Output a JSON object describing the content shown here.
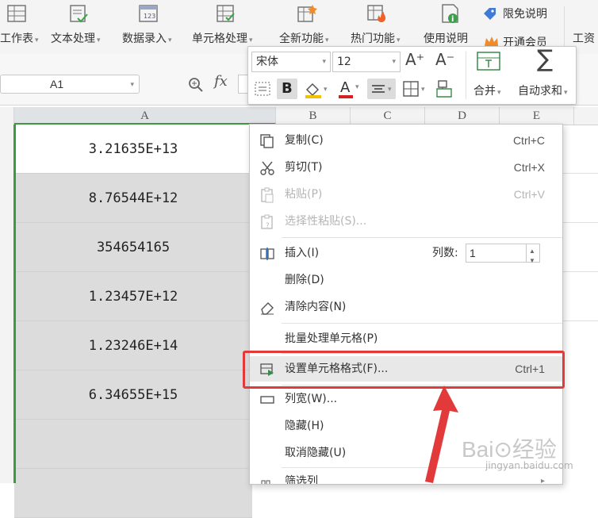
{
  "ribbon": {
    "items": [
      {
        "label": "工作表"
      },
      {
        "label": "文本处理"
      },
      {
        "label": "数据录入"
      },
      {
        "label": "单元格处理"
      },
      {
        "label": "全新功能"
      },
      {
        "label": "热门功能"
      },
      {
        "label": "使用说明"
      }
    ],
    "free_link": "限免说明",
    "vip_link": "开通会员",
    "tools_label": "工资"
  },
  "formula_bar": {
    "name_box": "A1",
    "fx_label": "fx"
  },
  "columns": [
    "A",
    "B",
    "C",
    "D",
    "E"
  ],
  "cells": [
    "3.21635E+13",
    "8.76544E+12",
    "354654165",
    "1.23457E+12",
    "1.23246E+14",
    "6.34655E+15"
  ],
  "mini_toolbar": {
    "font_name": "宋体",
    "font_size": "12",
    "bold_glyph": "B",
    "font_color_glyph": "A",
    "grow_glyph": "A⁺",
    "shrink_glyph": "A⁻",
    "sigma_glyph": "∑",
    "merge_label": "合并",
    "autosum_label": "自动求和"
  },
  "context_menu": {
    "items": [
      {
        "label": "复制(C)",
        "shortcut": "Ctrl+C",
        "icon": "copy-icon"
      },
      {
        "label": "剪切(T)",
        "shortcut": "Ctrl+X",
        "icon": "scissors-icon"
      },
      {
        "label": "粘贴(P)",
        "shortcut": "Ctrl+V",
        "icon": "paste-icon"
      },
      {
        "label": "选择性粘贴(S)...",
        "shortcut": "",
        "icon": "paste-special-icon"
      },
      {
        "label": "插入(I)",
        "shortcut": "",
        "icon": "insert-icon"
      },
      {
        "label": "删除(D)",
        "shortcut": "",
        "icon": ""
      },
      {
        "label": "清除内容(N)",
        "shortcut": "",
        "icon": "eraser-icon"
      },
      {
        "label": "批量处理单元格(P)",
        "shortcut": "",
        "icon": ""
      },
      {
        "label": "设置单元格格式(F)...",
        "shortcut": "Ctrl+1",
        "icon": "format-cells-icon"
      },
      {
        "label": "列宽(W)...",
        "shortcut": "",
        "icon": "column-width-icon"
      },
      {
        "label": "隐藏(H)",
        "shortcut": "",
        "icon": ""
      },
      {
        "label": "取消隐藏(U)",
        "shortcut": "",
        "icon": ""
      },
      {
        "label": "筛选列",
        "shortcut": "",
        "icon": "filter-icon"
      }
    ],
    "insert_columns_label": "列数:",
    "insert_columns_value": "1"
  },
  "watermark": {
    "brand": "Bai⊙经验",
    "url": "jingyan.baidu.com"
  },
  "colors": {
    "selection_green": "#3e9a3e",
    "highlight_red": "#e23a3a",
    "font_color_red": "#d42020"
  }
}
